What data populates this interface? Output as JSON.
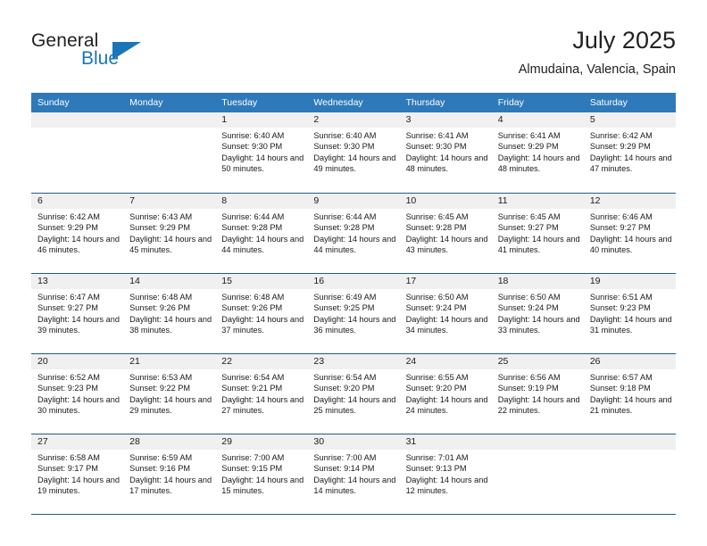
{
  "brand": {
    "name_general": "General",
    "name_blue": "Blue",
    "accent_color": "#1b75bb"
  },
  "header": {
    "month_title": "July 2025",
    "location": "Almudaina, Valencia, Spain"
  },
  "calendar": {
    "header_bg": "#2e79b9",
    "daynum_bg": "#f0f0f0",
    "row_divider": "#1d5c96",
    "weekday_headers": [
      "Sunday",
      "Monday",
      "Tuesday",
      "Wednesday",
      "Thursday",
      "Friday",
      "Saturday"
    ],
    "weeks": [
      [
        {
          "day": ""
        },
        {
          "day": ""
        },
        {
          "day": "1",
          "sunrise": "Sunrise: 6:40 AM",
          "sunset": "Sunset: 9:30 PM",
          "daylight": "Daylight: 14 hours and 50 minutes."
        },
        {
          "day": "2",
          "sunrise": "Sunrise: 6:40 AM",
          "sunset": "Sunset: 9:30 PM",
          "daylight": "Daylight: 14 hours and 49 minutes."
        },
        {
          "day": "3",
          "sunrise": "Sunrise: 6:41 AM",
          "sunset": "Sunset: 9:30 PM",
          "daylight": "Daylight: 14 hours and 48 minutes."
        },
        {
          "day": "4",
          "sunrise": "Sunrise: 6:41 AM",
          "sunset": "Sunset: 9:29 PM",
          "daylight": "Daylight: 14 hours and 48 minutes."
        },
        {
          "day": "5",
          "sunrise": "Sunrise: 6:42 AM",
          "sunset": "Sunset: 9:29 PM",
          "daylight": "Daylight: 14 hours and 47 minutes."
        }
      ],
      [
        {
          "day": "6",
          "sunrise": "Sunrise: 6:42 AM",
          "sunset": "Sunset: 9:29 PM",
          "daylight": "Daylight: 14 hours and 46 minutes."
        },
        {
          "day": "7",
          "sunrise": "Sunrise: 6:43 AM",
          "sunset": "Sunset: 9:29 PM",
          "daylight": "Daylight: 14 hours and 45 minutes."
        },
        {
          "day": "8",
          "sunrise": "Sunrise: 6:44 AM",
          "sunset": "Sunset: 9:28 PM",
          "daylight": "Daylight: 14 hours and 44 minutes."
        },
        {
          "day": "9",
          "sunrise": "Sunrise: 6:44 AM",
          "sunset": "Sunset: 9:28 PM",
          "daylight": "Daylight: 14 hours and 44 minutes."
        },
        {
          "day": "10",
          "sunrise": "Sunrise: 6:45 AM",
          "sunset": "Sunset: 9:28 PM",
          "daylight": "Daylight: 14 hours and 43 minutes."
        },
        {
          "day": "11",
          "sunrise": "Sunrise: 6:45 AM",
          "sunset": "Sunset: 9:27 PM",
          "daylight": "Daylight: 14 hours and 41 minutes."
        },
        {
          "day": "12",
          "sunrise": "Sunrise: 6:46 AM",
          "sunset": "Sunset: 9:27 PM",
          "daylight": "Daylight: 14 hours and 40 minutes."
        }
      ],
      [
        {
          "day": "13",
          "sunrise": "Sunrise: 6:47 AM",
          "sunset": "Sunset: 9:27 PM",
          "daylight": "Daylight: 14 hours and 39 minutes."
        },
        {
          "day": "14",
          "sunrise": "Sunrise: 6:48 AM",
          "sunset": "Sunset: 9:26 PM",
          "daylight": "Daylight: 14 hours and 38 minutes."
        },
        {
          "day": "15",
          "sunrise": "Sunrise: 6:48 AM",
          "sunset": "Sunset: 9:26 PM",
          "daylight": "Daylight: 14 hours and 37 minutes."
        },
        {
          "day": "16",
          "sunrise": "Sunrise: 6:49 AM",
          "sunset": "Sunset: 9:25 PM",
          "daylight": "Daylight: 14 hours and 36 minutes."
        },
        {
          "day": "17",
          "sunrise": "Sunrise: 6:50 AM",
          "sunset": "Sunset: 9:24 PM",
          "daylight": "Daylight: 14 hours and 34 minutes."
        },
        {
          "day": "18",
          "sunrise": "Sunrise: 6:50 AM",
          "sunset": "Sunset: 9:24 PM",
          "daylight": "Daylight: 14 hours and 33 minutes."
        },
        {
          "day": "19",
          "sunrise": "Sunrise: 6:51 AM",
          "sunset": "Sunset: 9:23 PM",
          "daylight": "Daylight: 14 hours and 31 minutes."
        }
      ],
      [
        {
          "day": "20",
          "sunrise": "Sunrise: 6:52 AM",
          "sunset": "Sunset: 9:23 PM",
          "daylight": "Daylight: 14 hours and 30 minutes."
        },
        {
          "day": "21",
          "sunrise": "Sunrise: 6:53 AM",
          "sunset": "Sunset: 9:22 PM",
          "daylight": "Daylight: 14 hours and 29 minutes."
        },
        {
          "day": "22",
          "sunrise": "Sunrise: 6:54 AM",
          "sunset": "Sunset: 9:21 PM",
          "daylight": "Daylight: 14 hours and 27 minutes."
        },
        {
          "day": "23",
          "sunrise": "Sunrise: 6:54 AM",
          "sunset": "Sunset: 9:20 PM",
          "daylight": "Daylight: 14 hours and 25 minutes."
        },
        {
          "day": "24",
          "sunrise": "Sunrise: 6:55 AM",
          "sunset": "Sunset: 9:20 PM",
          "daylight": "Daylight: 14 hours and 24 minutes."
        },
        {
          "day": "25",
          "sunrise": "Sunrise: 6:56 AM",
          "sunset": "Sunset: 9:19 PM",
          "daylight": "Daylight: 14 hours and 22 minutes."
        },
        {
          "day": "26",
          "sunrise": "Sunrise: 6:57 AM",
          "sunset": "Sunset: 9:18 PM",
          "daylight": "Daylight: 14 hours and 21 minutes."
        }
      ],
      [
        {
          "day": "27",
          "sunrise": "Sunrise: 6:58 AM",
          "sunset": "Sunset: 9:17 PM",
          "daylight": "Daylight: 14 hours and 19 minutes."
        },
        {
          "day": "28",
          "sunrise": "Sunrise: 6:59 AM",
          "sunset": "Sunset: 9:16 PM",
          "daylight": "Daylight: 14 hours and 17 minutes."
        },
        {
          "day": "29",
          "sunrise": "Sunrise: 7:00 AM",
          "sunset": "Sunset: 9:15 PM",
          "daylight": "Daylight: 14 hours and 15 minutes."
        },
        {
          "day": "30",
          "sunrise": "Sunrise: 7:00 AM",
          "sunset": "Sunset: 9:14 PM",
          "daylight": "Daylight: 14 hours and 14 minutes."
        },
        {
          "day": "31",
          "sunrise": "Sunrise: 7:01 AM",
          "sunset": "Sunset: 9:13 PM",
          "daylight": "Daylight: 14 hours and 12 minutes."
        },
        {
          "day": ""
        },
        {
          "day": ""
        }
      ]
    ]
  }
}
